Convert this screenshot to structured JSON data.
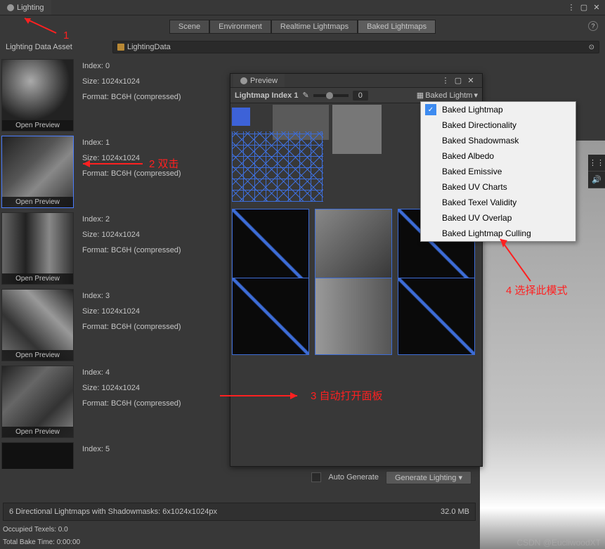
{
  "window": {
    "title": "Lighting"
  },
  "tabs": {
    "scene": "Scene",
    "environment": "Environment",
    "realtime": "Realtime Lightmaps",
    "baked": "Baked Lightmaps"
  },
  "asset": {
    "label": "Lighting Data Asset",
    "value": "LightingData"
  },
  "lightmaps": [
    {
      "index_label": "Index: 0",
      "size_label": "Size: 1024x1024",
      "format_label": "Format: BC6H (compressed)",
      "open": "Open Preview"
    },
    {
      "index_label": "Index: 1",
      "size_label": "Size: 1024x1024",
      "format_label": "Format: BC6H (compressed)",
      "open": "Open Preview"
    },
    {
      "index_label": "Index: 2",
      "size_label": "Size: 1024x1024",
      "format_label": "Format: BC6H (compressed)",
      "open": "Open Preview"
    },
    {
      "index_label": "Index: 3",
      "size_label": "Size: 1024x1024",
      "format_label": "Format: BC6H (compressed)",
      "open": "Open Preview"
    },
    {
      "index_label": "Index: 4",
      "size_label": "Size: 1024x1024",
      "format_label": "Format: BC6H (compressed)",
      "open": "Open Preview"
    },
    {
      "index_label": "Index: 5",
      "size_label": "",
      "format_label": "",
      "open": ""
    }
  ],
  "preview": {
    "tab": "Preview",
    "title": "Lightmap Index 1",
    "slider_value": "0",
    "mode_display": "Baked Lightm"
  },
  "dropdown": {
    "items": [
      "Baked Lightmap",
      "Baked Directionality",
      "Baked Shadowmask",
      "Baked Albedo",
      "Baked Emissive",
      "Baked UV Charts",
      "Baked Texel Validity",
      "Baked UV Overlap",
      "Baked Lightmap Culling"
    ]
  },
  "bottom": {
    "auto_generate": "Auto Generate",
    "generate": "Generate Lighting"
  },
  "status": {
    "summary": "6 Directional Lightmaps with Shadowmasks: 6x1024x1024px",
    "size": "32.0 MB",
    "occupied": "Occupied Texels: 0.0",
    "bake_time": "Total Bake Time: 0:00:00"
  },
  "annotations": {
    "a1": "1",
    "a2": "2 双击",
    "a3": "3 自动打开面板",
    "a4": "4 选择此模式"
  },
  "watermark": "CSDN @EucliwoodXT"
}
